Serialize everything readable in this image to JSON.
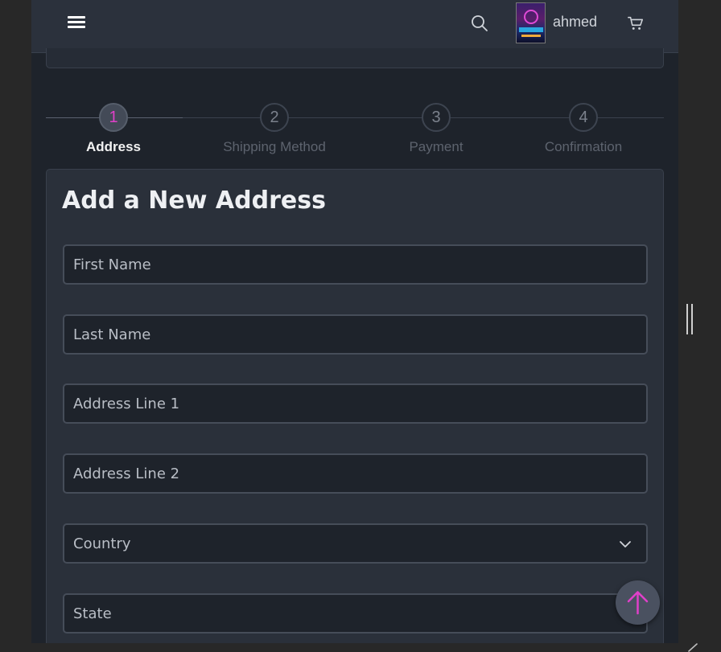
{
  "header": {
    "menu_icon": "hamburger-icon",
    "search_icon": "search-icon",
    "username": "ahmed",
    "cart_icon": "cart-icon"
  },
  "stepper": {
    "steps": [
      {
        "number": "1",
        "label": "Address",
        "active": true
      },
      {
        "number": "2",
        "label": "Shipping Method",
        "active": false
      },
      {
        "number": "3",
        "label": "Payment",
        "active": false
      },
      {
        "number": "4",
        "label": "Confirmation",
        "active": false
      }
    ]
  },
  "form": {
    "title": "Add a New Address",
    "first_name_placeholder": "First Name",
    "last_name_placeholder": "Last Name",
    "address_line1_placeholder": "Address Line 1",
    "address_line2_placeholder": "Address Line 2",
    "country_placeholder": "Country",
    "state_placeholder": "State"
  },
  "colors": {
    "accent": "#e040c9",
    "background": "#1e232b",
    "card": "#2a303a"
  },
  "back_to_top_icon": "arrow-up-icon"
}
